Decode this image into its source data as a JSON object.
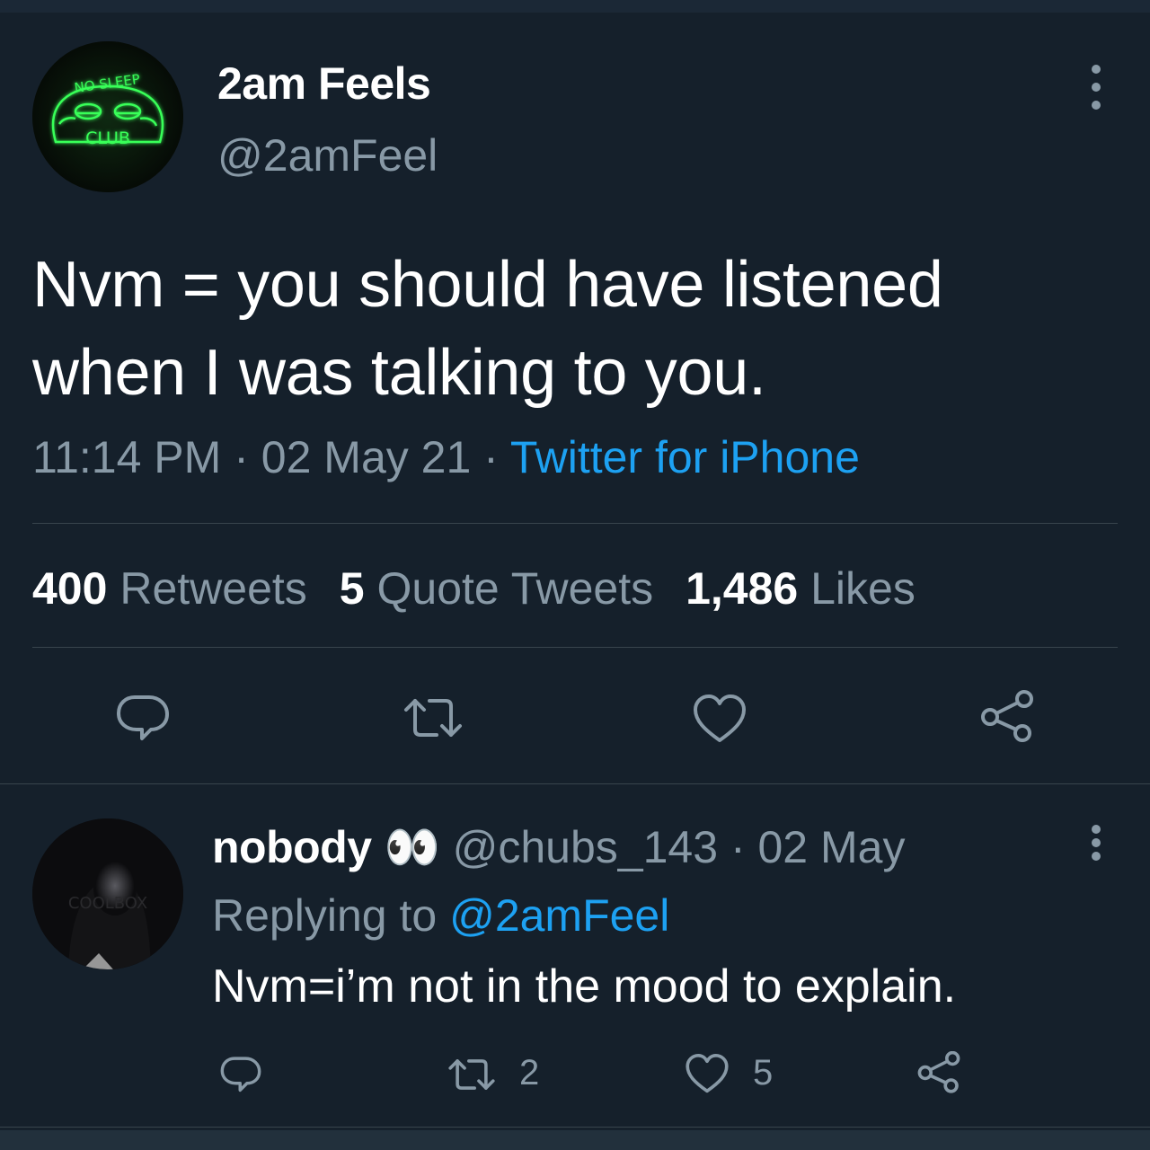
{
  "tweet": {
    "display_name": "2am Feels",
    "handle": "@2amFeel",
    "avatar_text_top": "NO SLEEP",
    "avatar_text_bottom": "CLUB",
    "text": "Nvm = you should have listened when I was talking to you.",
    "time": "11:14 PM",
    "date": "02 May 21",
    "separator": "·",
    "source": "Twitter for iPhone",
    "stats": {
      "retweets_count": "400",
      "retweets_label": "Retweets",
      "quotes_count": "5",
      "quotes_label": "Quote Tweets",
      "likes_count": "1,486",
      "likes_label": "Likes"
    }
  },
  "reply": {
    "display_name": "nobody",
    "emoji": "👀",
    "handle": "@chubs_143",
    "separator": "·",
    "date": "02 May",
    "replying_label": "Replying to",
    "replying_handle": "@2amFeel",
    "avatar_watermark": "COOLBOX",
    "text": "Nvm=i’m not in the mood to explain.",
    "retweet_count": "2",
    "like_count": "5"
  },
  "icons": {
    "reply": "speech-bubble-icon",
    "retweet": "retweet-arrows-icon",
    "like": "heart-outline-icon",
    "share": "share-nodes-icon",
    "more": "vertical-ellipsis-icon"
  },
  "colors": {
    "background": "#15202b",
    "text_primary": "#ffffff",
    "text_secondary": "#8899a6",
    "link": "#1da1f2",
    "neon_green": "#39ff59",
    "divider": "#38444d"
  }
}
